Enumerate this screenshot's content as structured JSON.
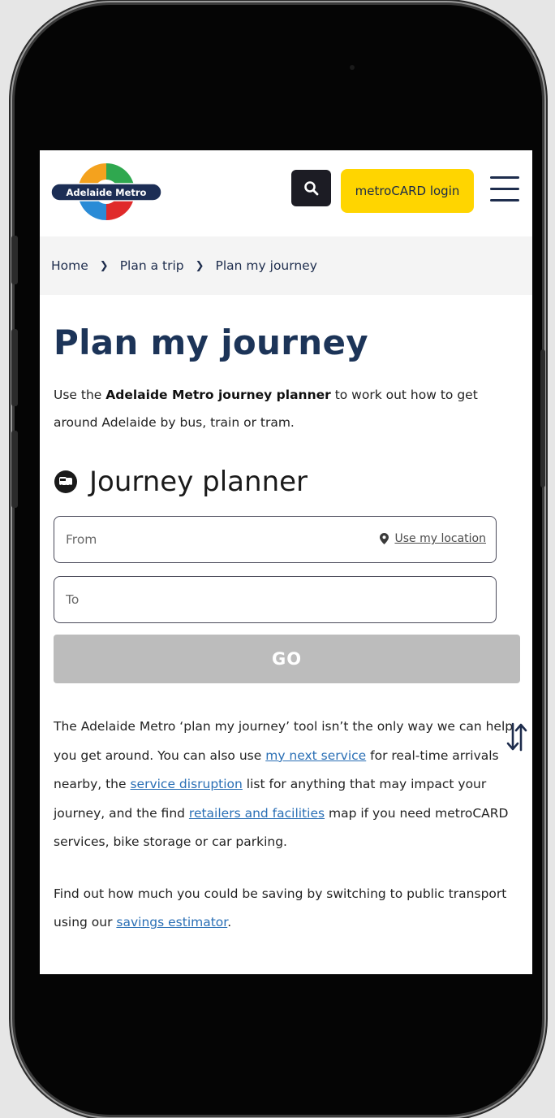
{
  "header": {
    "logo_text": "Adelaide Metro",
    "login_label": "metroCARD login",
    "search_icon": "search-icon",
    "menu_icon": "hamburger-menu-icon"
  },
  "breadcrumb": [
    "Home",
    "Plan a trip",
    "Plan my journey"
  ],
  "page": {
    "title": "Plan my journey",
    "intro_pre": "Use the ",
    "intro_bold": "Adelaide Metro journey planner",
    "intro_post": " to work out how to get around Adelaide by bus, train or tram."
  },
  "planner": {
    "heading": "Journey planner",
    "from_placeholder": "From",
    "to_placeholder": "To",
    "use_location": "Use my location",
    "go_label": "GO"
  },
  "info": {
    "p1_a": "The Adelaide Metro ‘plan my journey’ tool isn’t the only way we can help you get around. You can also use ",
    "link_next_service": "my next service",
    "p1_b": " for real-time arrivals nearby, the ",
    "link_disruption": "service disruption",
    "p1_c": " list for anything that may impact your journey, and the find ",
    "link_retailers": "retailers and facilities",
    "p1_d": " map if you need metroCARD services, bike storage or car parking.",
    "p2_a": "Find out how much you could be saving by switching to public transport using our ",
    "link_savings": "savings estimator",
    "p2_b": "."
  },
  "colors": {
    "brand_navy": "#1c3458",
    "accent_yellow": "#ffd500",
    "link_blue": "#2a6fb5",
    "go_disabled": "#bcbcbc"
  }
}
